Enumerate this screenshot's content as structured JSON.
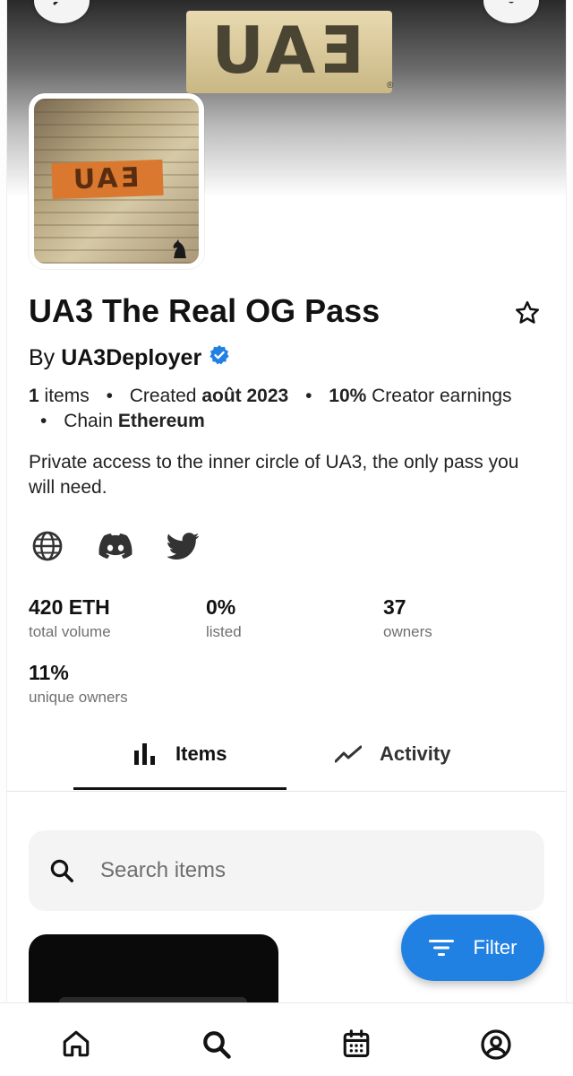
{
  "banner": {
    "logo_text": "UAƎ",
    "reg_mark": "®"
  },
  "avatar": {
    "tag_text": "UAƎ"
  },
  "header": {
    "title": "UA3 The Real OG Pass",
    "by_label": "By",
    "creator": "UA3Deployer"
  },
  "meta": {
    "items_count": "1",
    "items_label": "items",
    "created_label": "Created",
    "created_value": "août 2023",
    "earnings_value": "10%",
    "earnings_label": "Creator earnings",
    "chain_label": "Chain",
    "chain_value": "Ethereum",
    "separator": "•"
  },
  "description": "Private access to the inner circle of UA3, the only pass you will need.",
  "socials": [
    "globe-icon",
    "discord-icon",
    "twitter-icon"
  ],
  "stats": [
    {
      "value": "420 ETH",
      "label": "total volume"
    },
    {
      "value": "0%",
      "label": "listed"
    },
    {
      "value": "37",
      "label": "owners"
    },
    {
      "value": "11%",
      "label": "unique owners"
    }
  ],
  "tabs": [
    {
      "label": "Items",
      "icon": "bar-chart-icon",
      "active": true
    },
    {
      "label": "Activity",
      "icon": "trend-line-icon",
      "active": false
    }
  ],
  "search": {
    "placeholder": "Search items"
  },
  "filter": {
    "label": "Filter"
  },
  "bottom_nav": [
    "home-icon",
    "search-icon",
    "calendar-icon",
    "profile-icon"
  ],
  "colors": {
    "accent": "#2081e2",
    "verified": "#2081e2",
    "text": "#121212",
    "muted": "#707070"
  }
}
